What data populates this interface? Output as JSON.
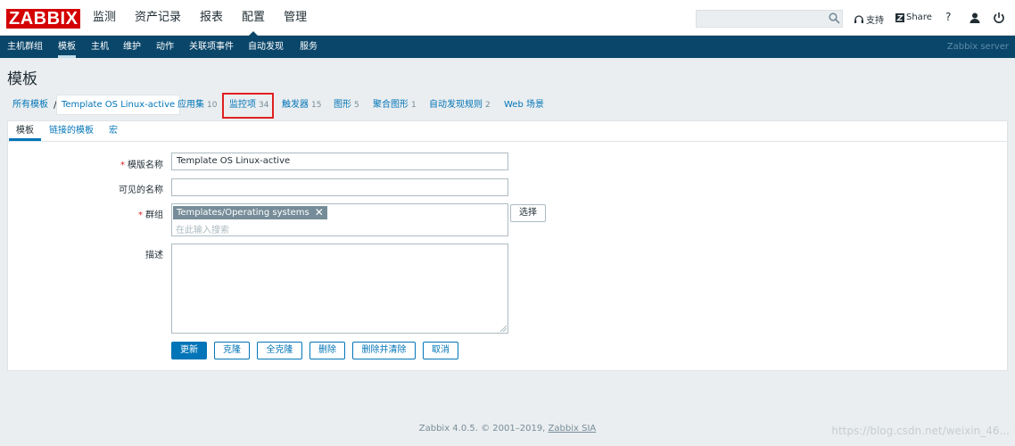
{
  "header": {
    "logo": "ZABBIX",
    "menu": [
      "监测",
      "资产记录",
      "报表",
      "配置",
      "管理"
    ],
    "support": "支持",
    "share": "Share",
    "help": "?"
  },
  "subnav": {
    "items": [
      "主机群组",
      "模板",
      "主机",
      "维护",
      "动作",
      "关联项事件",
      "自动发现",
      "服务"
    ],
    "server": "Zabbix server"
  },
  "page": {
    "title": "模板"
  },
  "breadcrumb": {
    "all": "所有模板",
    "sep": "/",
    "current": "Template OS Linux-active",
    "tabs": [
      {
        "label": "应用集",
        "count": "10"
      },
      {
        "label": "监控项",
        "count": "34"
      },
      {
        "label": "触发器",
        "count": "15"
      },
      {
        "label": "图形",
        "count": "5"
      },
      {
        "label": "聚合图形",
        "count": "1"
      },
      {
        "label": "自动发现规则",
        "count": "2"
      },
      {
        "label": "Web 场景",
        "count": ""
      }
    ]
  },
  "form": {
    "tabs": [
      "模板",
      "链接的模板",
      "宏"
    ],
    "required_mark": "*",
    "name_label": "模版名称",
    "name_value": "Template OS Linux-active",
    "visible_label": "可见的名称",
    "visible_value": "",
    "groups_label": "群组",
    "group_tag": "Templates/Operating systems",
    "group_remove": "✕",
    "groups_placeholder": "在此输入搜索",
    "select_button": "选择",
    "desc_label": "描述",
    "desc_value": "",
    "buttons": {
      "update": "更新",
      "clone": "克隆",
      "full_clone": "全克隆",
      "delete": "删除",
      "delete_clear": "删除并清除",
      "cancel": "取消"
    }
  },
  "footer": {
    "text": "Zabbix 4.0.5. © 2001–2019,",
    "link": "Zabbix SIA"
  },
  "watermark": "https://blog.csdn.net/weixin_46...",
  "colors": {
    "brand": "#d40000",
    "nav": "#0a466a",
    "link": "#0275b8",
    "highlight": "#e02020"
  }
}
